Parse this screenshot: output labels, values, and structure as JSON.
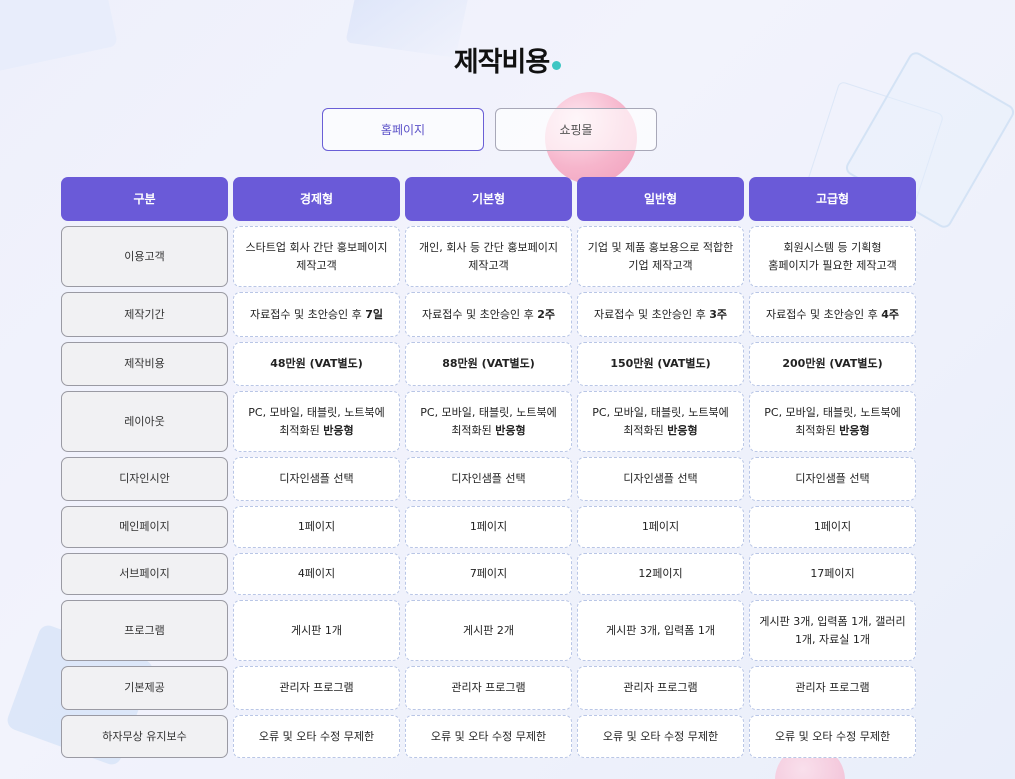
{
  "title": "제작비용",
  "tabs": [
    {
      "label": "홈페이지",
      "active": true
    },
    {
      "label": "쇼핑몰",
      "active": false
    }
  ],
  "table": {
    "headers": [
      "구분",
      "경제형",
      "기본형",
      "일반형",
      "고급형"
    ],
    "rows": [
      {
        "label": "이용고객",
        "cells": [
          [
            "스타트업 회사 간단 홍보페이지",
            "제작고객"
          ],
          [
            "개인, 회사 등 간단 홍보페이지",
            "제작고객"
          ],
          [
            "기업 및 제품 홍보용으로 적합한",
            "기업 제작고객"
          ],
          [
            "회원시스템 등 기획형",
            "홈페이지가 필요한 제작고객"
          ]
        ]
      },
      {
        "label": "제작기간",
        "cells": [
          {
            "pre": "자료접수 및 초안승인 후 ",
            "bold": "7일"
          },
          {
            "pre": "자료접수 및 초안승인 후 ",
            "bold": "2주"
          },
          {
            "pre": "자료접수 및 초안승인 후 ",
            "bold": "3주"
          },
          {
            "pre": "자료접수 및 초안승인 후 ",
            "bold": "4주"
          }
        ]
      },
      {
        "label": "제작비용",
        "cells": [
          {
            "pre": "",
            "bold": "48만원 (VAT별도)"
          },
          {
            "pre": "",
            "bold": "88만원 (VAT별도)"
          },
          {
            "pre": "",
            "bold": "150만원 (VAT별도)"
          },
          {
            "pre": "",
            "bold": "200만원 (VAT별도)"
          }
        ]
      },
      {
        "label": "레이아웃",
        "cells": [
          {
            "line1": "PC, 모바일, 태블릿, 노트북에",
            "pre": "최적화된 ",
            "bold": "반응형"
          },
          {
            "line1": "PC, 모바일, 태블릿, 노트북에",
            "pre": "최적화된 ",
            "bold": "반응형"
          },
          {
            "line1": "PC, 모바일, 태블릿, 노트북에",
            "pre": "최적화된 ",
            "bold": "반응형"
          },
          {
            "line1": "PC, 모바일, 태블릿, 노트북에",
            "pre": "최적화된 ",
            "bold": "반응형"
          }
        ]
      },
      {
        "label": "디자인시안",
        "cells": [
          [
            "디자인샘플 선택"
          ],
          [
            "디자인샘플 선택"
          ],
          [
            "디자인샘플 선택"
          ],
          [
            "디자인샘플 선택"
          ]
        ]
      },
      {
        "label": "메인페이지",
        "cells": [
          [
            "1페이지"
          ],
          [
            "1페이지"
          ],
          [
            "1페이지"
          ],
          [
            "1페이지"
          ]
        ]
      },
      {
        "label": "서브페이지",
        "cells": [
          [
            "4페이지"
          ],
          [
            "7페이지"
          ],
          [
            "12페이지"
          ],
          [
            "17페이지"
          ]
        ]
      },
      {
        "label": "프로그램",
        "cells": [
          [
            "게시판 1개"
          ],
          [
            "게시판 2개"
          ],
          [
            "게시판 3개, 입력폼 1개"
          ],
          [
            "게시판 3개, 입력폼 1개, 갤러리",
            "1개, 자료실 1개"
          ]
        ]
      },
      {
        "label": "기본제공",
        "cells": [
          [
            "관리자 프로그램"
          ],
          [
            "관리자 프로그램"
          ],
          [
            "관리자 프로그램"
          ],
          [
            "관리자 프로그램"
          ]
        ]
      },
      {
        "label": "하자무상 유지보수",
        "cells": [
          [
            "오류 및 오타 수정 무제한"
          ],
          [
            "오류 및 오타 수정 무제한"
          ],
          [
            "오류 및 오타 수정 무제한"
          ],
          [
            "오류 및 오타 수정 무제한"
          ]
        ]
      }
    ]
  },
  "colors": {
    "accent": "#6a5ad8",
    "title_dot": "#3ec6c3",
    "label_bg": "#f1f1f3"
  }
}
